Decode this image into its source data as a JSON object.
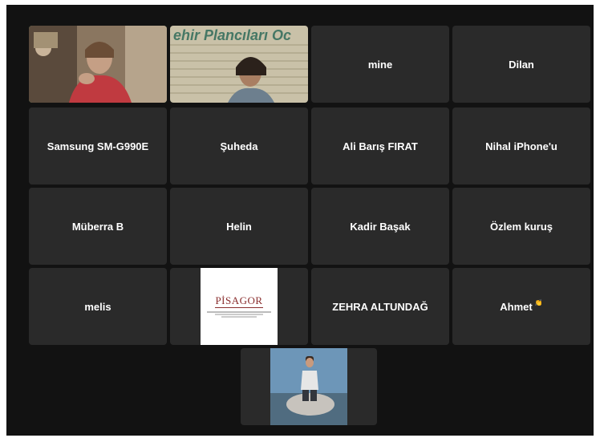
{
  "meeting": {
    "participants": [
      {
        "id": "p1",
        "name": "",
        "type": "video",
        "active": true
      },
      {
        "id": "p2",
        "name": "",
        "type": "video",
        "background_text": "ehir Plancıları Oc"
      },
      {
        "id": "p3",
        "name": "mine",
        "type": "name"
      },
      {
        "id": "p4",
        "name": "Dilan",
        "type": "name"
      },
      {
        "id": "p5",
        "name": "Samsung SM-G990E",
        "type": "name"
      },
      {
        "id": "p6",
        "name": "Şuheda",
        "type": "name"
      },
      {
        "id": "p7",
        "name": "Ali Barış FIRAT",
        "type": "name"
      },
      {
        "id": "p8",
        "name": "Nihal iPhone'u",
        "type": "name"
      },
      {
        "id": "p9",
        "name": "Müberra B",
        "type": "name"
      },
      {
        "id": "p10",
        "name": "Helin",
        "type": "name"
      },
      {
        "id": "p11",
        "name": "Kadir Başak",
        "type": "name"
      },
      {
        "id": "p12",
        "name": "Özlem kuruş",
        "type": "name"
      },
      {
        "id": "p13",
        "name": "melis",
        "type": "name"
      },
      {
        "id": "p14",
        "name": "",
        "type": "logo",
        "logo_text": "PİSAGOR"
      },
      {
        "id": "p15",
        "name": "ZEHRA ALTUNDAĞ",
        "type": "name"
      },
      {
        "id": "p16",
        "name": "Ahmet",
        "type": "name",
        "emoji": "👏"
      },
      {
        "id": "p17",
        "name": "",
        "type": "video"
      }
    ]
  },
  "colors": {
    "background": "#121212",
    "tile": "#2a2a2a",
    "active_speaker_border": "#35c76b",
    "text": "#ffffff"
  }
}
